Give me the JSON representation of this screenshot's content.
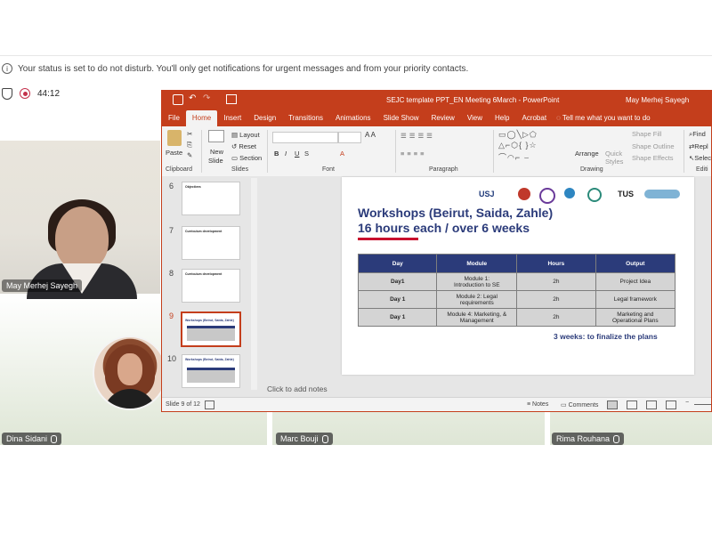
{
  "teams": {
    "dnd_banner": "Your status is set to do not disturb. You'll only get notifications for urgent messages and from your priority contacts.",
    "timer": "44:12",
    "participants": [
      {
        "name": "May Merhej Sayegh"
      },
      {
        "name": "Dina Sidani"
      },
      {
        "name": "Marc Bouji"
      },
      {
        "name": "Rima Rouhana"
      }
    ]
  },
  "ppt": {
    "window_title": "SEJC template PPT_EN Meeting 6March  -  PowerPoint",
    "user": "May Merhej Sayegh",
    "tabs": [
      "File",
      "Home",
      "Insert",
      "Design",
      "Transitions",
      "Animations",
      "Slide Show",
      "Review",
      "View",
      "Help",
      "Acrobat"
    ],
    "active_tab": "Home",
    "tell_me": "Tell me what you want to do",
    "ribbon": {
      "clipboard": {
        "label": "Clipboard",
        "paste": "Paste"
      },
      "slides": {
        "label": "Slides",
        "new_slide_1": "New",
        "new_slide_2": "Slide",
        "layout": "Layout",
        "reset": "Reset",
        "section": "Section"
      },
      "font": {
        "label": "Font"
      },
      "paragraph": {
        "label": "Paragraph"
      },
      "drawing": {
        "label": "Drawing",
        "arrange": "Arrange",
        "quick_styles_1": "Quick",
        "quick_styles_2": "Styles",
        "shape_fill": "Shape Fill",
        "shape_outline": "Shape Outline",
        "shape_effects": "Shape Effects"
      },
      "editing": {
        "label": "Editi",
        "find": "Find",
        "replace": "Repl",
        "select": "Selec"
      }
    },
    "thumbnails": [
      {
        "num": "6",
        "title": "Objectives"
      },
      {
        "num": "7",
        "title": "Curriculum development"
      },
      {
        "num": "8",
        "title": "Curriculum development"
      },
      {
        "num": "9",
        "title": "Workshops (Beirut, Saida, Zahle)"
      },
      {
        "num": "10",
        "title": "Workshops (Beirut, Saida, Zahle)"
      }
    ],
    "slide": {
      "logos": [
        "USJ",
        "TUS"
      ],
      "title_line1": "Workshops (Beirut, Saida, Zahle)",
      "title_line2": "16 hours each / over 6 weeks",
      "table": {
        "headers": [
          "Day",
          "Module",
          "Hours",
          "Output"
        ],
        "rows": [
          [
            "Day1",
            "Module 1:\nIntroduction to SE",
            "2h",
            "Project Idea"
          ],
          [
            "Day 1",
            "Module 2: Legal\nrequirements",
            "2h",
            "Legal framework"
          ],
          [
            "Day 1",
            "Module 4: Marketing, &\nManagement",
            "2h",
            "Marketing and\nOperational Plans"
          ]
        ]
      },
      "footer_note": "3 weeks: to finalize the plans"
    },
    "notes_placeholder": "Click to add notes",
    "status": {
      "slide_count": "Slide 9 of 12",
      "notes": "Notes",
      "comments": "Comments"
    },
    "colors": {
      "accent": "#c43e1c",
      "table_header": "#2b3b7a",
      "title": "#2b3b7a"
    }
  }
}
